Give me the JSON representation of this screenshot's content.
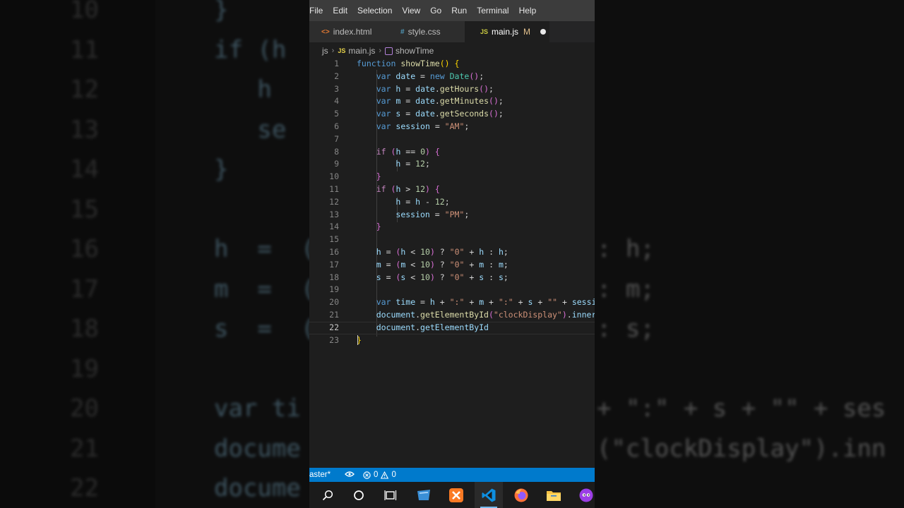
{
  "menu": [
    "File",
    "Edit",
    "Selection",
    "View",
    "Go",
    "Run",
    "Terminal",
    "Help"
  ],
  "tabs": [
    {
      "name": "index.html",
      "icon": "html-file-icon",
      "icon_glyph": "<>",
      "icon_color": "#e37933"
    },
    {
      "name": "style.css",
      "icon": "css-file-icon",
      "icon_glyph": "#",
      "icon_color": "#519aba"
    },
    {
      "name": "main.js",
      "icon": "js-file-icon",
      "icon_glyph": "JS",
      "icon_color": "#cbcb41",
      "modified": "M",
      "active": true
    }
  ],
  "breadcrumb": {
    "folder": "js",
    "file": "main.js",
    "symbol": "showTime"
  },
  "current_line": 22,
  "status": {
    "branch": "aster*",
    "errors": "0",
    "warnings": "0"
  },
  "background_lines": [
    {
      "num": "10",
      "text": "}",
      "right": ""
    },
    {
      "num": "11",
      "text": "if (h",
      "right": ""
    },
    {
      "num": "12",
      "text": "   h",
      "right": ""
    },
    {
      "num": "13",
      "text": "   se",
      "right": ""
    },
    {
      "num": "14",
      "text": "}",
      "right": ""
    },
    {
      "num": "15",
      "text": "",
      "right": ""
    },
    {
      "num": "16",
      "text": "h  =  (h",
      "right": ": h;"
    },
    {
      "num": "17",
      "text": "m  =  (m",
      "right": ": m;"
    },
    {
      "num": "18",
      "text": "s  =  (s",
      "right": ": s;"
    },
    {
      "num": "19",
      "text": "",
      "right": ""
    },
    {
      "num": "20",
      "text": "var ti",
      "right": "+ \":\" + s + \"\" + ses"
    },
    {
      "num": "21",
      "text": "docume",
      "right": "(\"clockDisplay\").inn"
    },
    {
      "num": "22",
      "text": "docume",
      "right": ""
    }
  ],
  "taskbar": [
    {
      "icon": "search-icon"
    },
    {
      "icon": "cortana-icon"
    },
    {
      "icon": "task-view-icon"
    },
    {
      "icon": "app-icon"
    },
    {
      "icon": "xampp-icon"
    },
    {
      "icon": "vscode-icon",
      "active": true
    },
    {
      "icon": "firefox-icon"
    },
    {
      "icon": "file-explorer-icon"
    },
    {
      "icon": "app-purple-icon"
    }
  ],
  "code": [
    "function showTime() {",
    "    var date = new Date();",
    "    var h = date.getHours();",
    "    var m = date.getMinutes();",
    "    var s = date.getSeconds();",
    "    var session = \"AM\";",
    "",
    "    if (h == 0) {",
    "        h = 12;",
    "    }",
    "    if (h > 12) {",
    "        h = h - 12;",
    "        session = \"PM\";",
    "    }",
    "",
    "    h = (h < 10) ? \"0\" + h : h;",
    "    m = (m < 10) ? \"0\" + m : m;",
    "    s = (s < 10) ? \"0\" + s : s;",
    "",
    "    var time = h + \":\" + m + \":\" + s + \"\" + session;",
    "    document.getElementById(\"clockDisplay\").innerText = time;",
    "    document.getElementById",
    "}"
  ]
}
